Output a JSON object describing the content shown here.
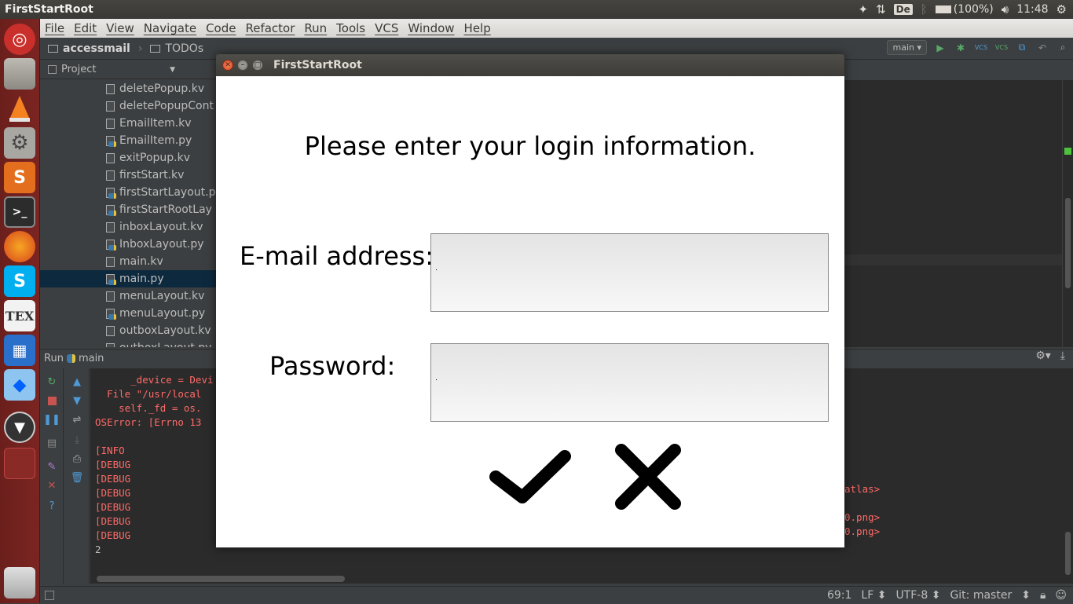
{
  "top_panel": {
    "app_title": "FirstStartRoot",
    "keyboard_layout": "De",
    "battery": "(100%)",
    "time": "11:48"
  },
  "launcher": {
    "items": [
      "ubuntu-dash",
      "files",
      "vlc",
      "system-settings",
      "sublime",
      "terminal",
      "firefox",
      "skype",
      "texmaker",
      "calculator",
      "dropbox",
      "kivy",
      "workspaces",
      "trash"
    ]
  },
  "ide": {
    "menu": [
      "File",
      "Edit",
      "View",
      "Navigate",
      "Code",
      "Refactor",
      "Run",
      "Tools",
      "VCS",
      "Window",
      "Help"
    ],
    "breadcrumb": {
      "project": "accessmail",
      "folder": "TODOs"
    },
    "run_config": "main",
    "project_panel_title": "Project",
    "files": [
      {
        "name": "deletePopup.kv",
        "type": "kv"
      },
      {
        "name": "deletePopupCont",
        "type": "kv"
      },
      {
        "name": "EmailItem.kv",
        "type": "kv"
      },
      {
        "name": "EmailItem.py",
        "type": "py"
      },
      {
        "name": "exitPopup.kv",
        "type": "kv"
      },
      {
        "name": "firstStart.kv",
        "type": "kv"
      },
      {
        "name": "firstStartLayout.p",
        "type": "py"
      },
      {
        "name": "firstStartRootLay",
        "type": "py"
      },
      {
        "name": "inboxLayout.kv",
        "type": "kv"
      },
      {
        "name": "InboxLayout.py",
        "type": "py"
      },
      {
        "name": "main.kv",
        "type": "kv"
      },
      {
        "name": "main.py",
        "type": "py"
      },
      {
        "name": "menuLayout.kv",
        "type": "kv"
      },
      {
        "name": "menuLayout.py",
        "type": "py"
      },
      {
        "name": "outboxLayout.kv",
        "type": "kv"
      },
      {
        "name": "outboxLayout.py",
        "type": "py"
      }
    ],
    "run_tab": {
      "label": "Run",
      "config": "main"
    },
    "console_lines": [
      "      _device = Devi",
      "  File \"/usr/local",
      "    self._fd = os.",
      "OSError: [Errno 13",
      "",
      "[INFO",
      "[DEBUG",
      "[DEBUG",
      "[DEBUG",
      "[DEBUG",
      "[DEBUG",
      "[DEBUG",
      "2"
    ],
    "console_right": [
      "atlas>",
      "",
      "0.png>",
      "0.png>"
    ],
    "status": {
      "position": "69:1",
      "line_ending": "LF",
      "encoding": "UTF-8",
      "vcs": "Git: master"
    }
  },
  "dialog": {
    "title": "FirstStartRoot",
    "prompt": "Please enter your login information.",
    "email_label": "E-mail address:",
    "email_value": "",
    "password_label": "Password:",
    "password_value": "",
    "confirm_icon": "checkmark-icon",
    "cancel_icon": "cross-icon"
  }
}
